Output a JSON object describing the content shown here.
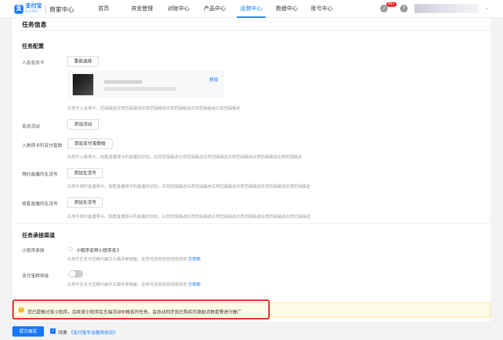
{
  "nav": {
    "logo_text": "支付宝",
    "logo_sub": "ALIPAY",
    "merchant_center": "商家中心",
    "items": [
      "首页",
      "资金管理",
      "对账中心",
      "产品中心",
      "运营中心",
      "数据中心",
      "账号中心"
    ],
    "active_index": 4,
    "badge": "99+"
  },
  "section1": {
    "title": "任务信息",
    "subtitle": "任务配置",
    "member_card_label": "入会会员卡",
    "reselect_button": "重新选择",
    "remove_link": "移除",
    "member_card_help": "应用于入会得卡、范围描述应用范围描述应用范围描述应用范围描述应用范围描述应用范围描述",
    "member_activity_label": "会员活动",
    "add_activity_button": "添加活动",
    "group_label": "入群得卡的支付宝群",
    "add_group_button": "添加支付宝群组",
    "group_help": "应用于入群得卡、观看直播得卡的直播间识别。应用范围描述应用范围描述应用范围描述应用范围描述应用范围描述应用范围描述",
    "reserve_live_label": "预约直播的生活号",
    "add_life_button": "添加生活号",
    "reserve_help": "应用于预约直播得卡、观看直播得卡的直播间识别。应用范围描述应用范围描述应用范围描述应用范围描述应用范围描述应用范围描述",
    "watch_live_label": "观看直播的生活号",
    "add_life_button2": "添加生活号",
    "watch_help": "应用于预约直播得卡、观看直播得卡的直播间识别。应用范围描述应用范围描述应用范围描述应用范围描述应用范围描述应用范围描述"
  },
  "section2": {
    "title": "任务承接渠道",
    "miniapp_label": "小程序承接",
    "miniapp_name": "小程序名称小程序名3",
    "miniapp_help": "应用于在支付宝群内展示五福半屏弹窗。任务可说明说明说明说明",
    "example_link": "示意图",
    "group_label": "支付宝群承接",
    "group_help": "应用于在支付宝群内展示五福半屏弹窗。任务可说明说明说明说明",
    "example_link2": "示意图"
  },
  "notice": {
    "text": "您已提报过该小程序。后续该小程序在五福活动中报名的任务，会自动同步到已购买的激励点数套餐进行推广"
  },
  "footer": {
    "submit_button": "提交报名",
    "agree_prefix": "同意",
    "agreement_link": "《支付宝平台服务协议》"
  }
}
